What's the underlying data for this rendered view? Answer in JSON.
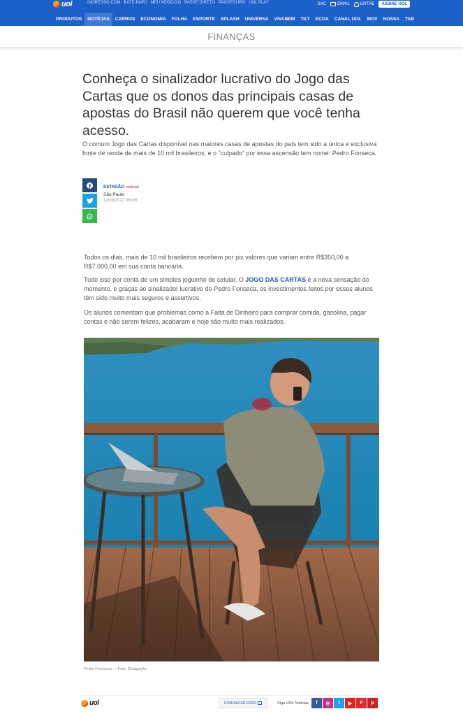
{
  "header": {
    "logo_text": "uol",
    "top_links": [
      "INGRESSO.COM",
      "BATE-PAPO",
      "MEU NEGÓCIO",
      "PASSE DIRETO",
      "PAGSEGURO",
      "UOL PLAY"
    ],
    "sac": "SAC",
    "email": "EMAIL",
    "entre": "ENTRE",
    "assine": "ASSINE UOL",
    "nav": [
      "PRODUTOS",
      "NOTÍCIAS",
      "CARROS",
      "ECONOMIA",
      "FOLHA",
      "ESPORTE",
      "SPLASH",
      "UNIVERSA",
      "VIVABEM",
      "TILT",
      "ECOA",
      "CANAL UOL",
      "MOV",
      "NOSSA",
      "TAB"
    ],
    "active_nav": "NOTÍCIAS",
    "brand_color": "#1c60c8"
  },
  "section": {
    "title": "FINANÇAS"
  },
  "article": {
    "headline": "Conheça o sinalizador lucrativo do Jogo das Cartas que os donos das principais casas de apostas do Brasil não querem que você tenha acesso.",
    "lede": "O comum Jogo das Cartas disponível nas maiores casas de apostas do país tem sido a única e exclusiva fonte de renda de mais de 10 mil brasileiros, e o “culpado” por essa ascensão tem nome: Pedro Fonseca.",
    "share": {
      "facebook": "f",
      "twitter": "t",
      "whatsapp": "w"
    },
    "source_brand": "ESTADÃO",
    "source_tag": "conteúdo",
    "place": "São Paulo",
    "date": "12/09/2022  05h00",
    "p1": "Todos os dias, mais de 10 mil brasileiros recebem por pix valores que variam entre R$350,00 a R$7.000,00 em sua conta bancária.",
    "p2_before": "Tudo isso por conta de um simples joguinho de celular. O ",
    "p2_link": "JOGO DAS CARTAS",
    "p2_after": " é a nova sensação do momento, e graças ao sinalizador lucrativo do Pedro Fonseca, os investimentos feitos por esses alunos têm sido muito mais seguros e assertivos.",
    "p3": "Os alunos comentam que problemas como a Falta de Dinheiro para comprar comida, gasolina, pagar contas e não serem felizes, acabaram e hoje são muito mais realizados.",
    "caption": "Pedro Foncesca — Foto: Divulgação"
  },
  "footer": {
    "logo_text": "uol",
    "erro": "COMUNICAR ERRO",
    "siga": "Siga UOL Notícias",
    "socials": [
      {
        "name": "facebook",
        "glyph": "f",
        "color": "#3b5998"
      },
      {
        "name": "instagram",
        "glyph": "◎",
        "color": "#c13584"
      },
      {
        "name": "twitter",
        "glyph": "t",
        "color": "#1da1f2"
      },
      {
        "name": "youtube",
        "glyph": "▶",
        "color": "#e62117"
      },
      {
        "name": "flipboard",
        "glyph": "F",
        "color": "#e12828"
      },
      {
        "name": "pinterest",
        "glyph": "p",
        "color": "#cb2027"
      }
    ]
  }
}
